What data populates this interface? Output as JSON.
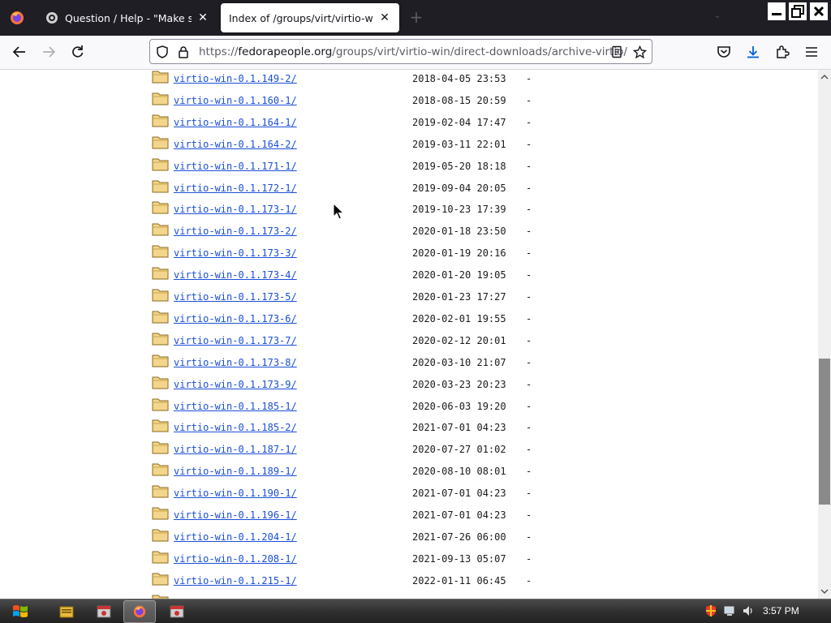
{
  "browser": {
    "tabs": [
      {
        "title": "Question / Help - \"Make sure y",
        "active": false
      },
      {
        "title": "Index of /groups/virt/virtio-win/dire",
        "active": true
      }
    ],
    "new_tab_label": "+",
    "url": {
      "scheme": "https://",
      "host": "fedorapeople.org",
      "path": "/groups/virt/virtio-win/direct-downloads/archive-virtio/"
    }
  },
  "listing": {
    "rows": [
      {
        "name": "virtio-win-0.1.149-2/",
        "date": "2018-04-05 23:53",
        "size": "-"
      },
      {
        "name": "virtio-win-0.1.160-1/",
        "date": "2018-08-15 20:59",
        "size": "-"
      },
      {
        "name": "virtio-win-0.1.164-1/",
        "date": "2019-02-04 17:47",
        "size": "-"
      },
      {
        "name": "virtio-win-0.1.164-2/",
        "date": "2019-03-11 22:01",
        "size": "-"
      },
      {
        "name": "virtio-win-0.1.171-1/",
        "date": "2019-05-20 18:18",
        "size": "-"
      },
      {
        "name": "virtio-win-0.1.172-1/",
        "date": "2019-09-04 20:05",
        "size": "-"
      },
      {
        "name": "virtio-win-0.1.173-1/",
        "date": "2019-10-23 17:39",
        "size": "-"
      },
      {
        "name": "virtio-win-0.1.173-2/",
        "date": "2020-01-18 23:50",
        "size": "-"
      },
      {
        "name": "virtio-win-0.1.173-3/",
        "date": "2020-01-19 20:16",
        "size": "-"
      },
      {
        "name": "virtio-win-0.1.173-4/",
        "date": "2020-01-20 19:05",
        "size": "-"
      },
      {
        "name": "virtio-win-0.1.173-5/",
        "date": "2020-01-23 17:27",
        "size": "-"
      },
      {
        "name": "virtio-win-0.1.173-6/",
        "date": "2020-02-01 19:55",
        "size": "-"
      },
      {
        "name": "virtio-win-0.1.173-7/",
        "date": "2020-02-12 20:01",
        "size": "-"
      },
      {
        "name": "virtio-win-0.1.173-8/",
        "date": "2020-03-10 21:07",
        "size": "-"
      },
      {
        "name": "virtio-win-0.1.173-9/",
        "date": "2020-03-23 20:23",
        "size": "-"
      },
      {
        "name": "virtio-win-0.1.185-1/",
        "date": "2020-06-03 19:20",
        "size": "-"
      },
      {
        "name": "virtio-win-0.1.185-2/",
        "date": "2021-07-01 04:23",
        "size": "-"
      },
      {
        "name": "virtio-win-0.1.187-1/",
        "date": "2020-07-27 01:02",
        "size": "-"
      },
      {
        "name": "virtio-win-0.1.189-1/",
        "date": "2020-08-10 08:01",
        "size": "-"
      },
      {
        "name": "virtio-win-0.1.190-1/",
        "date": "2021-07-01 04:23",
        "size": "-"
      },
      {
        "name": "virtio-win-0.1.196-1/",
        "date": "2021-07-01 04:23",
        "size": "-"
      },
      {
        "name": "virtio-win-0.1.204-1/",
        "date": "2021-07-26 06:00",
        "size": "-"
      },
      {
        "name": "virtio-win-0.1.208-1/",
        "date": "2021-09-13 05:07",
        "size": "-"
      },
      {
        "name": "virtio-win-0.1.215-1/",
        "date": "2022-01-11 06:45",
        "size": "-"
      }
    ]
  },
  "taskbar": {
    "clock": "3:57 PM",
    "apps": [
      "file-explorer",
      "app-red-1",
      "firefox",
      "app-red-2"
    ]
  },
  "colors": {
    "tabstrip_bg": "#1f1e25",
    "link": "#1a4fd6",
    "scroll_thumb": "#8a8a8a"
  }
}
